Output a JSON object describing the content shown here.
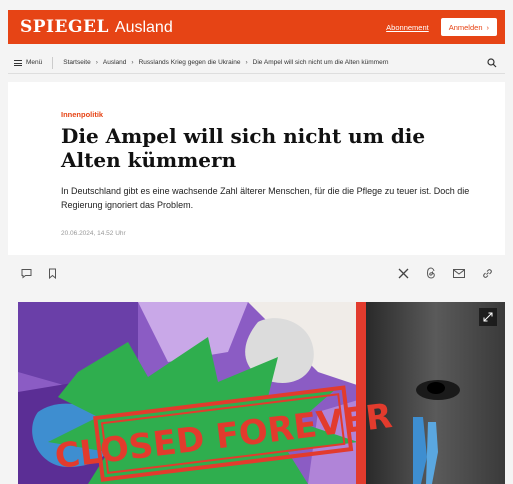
{
  "header": {
    "brand": "SPIEGEL",
    "section": "Ausland",
    "subscription_link": "Abonnement",
    "login_label": "Anmelden",
    "login_chevron": "›",
    "brand_color": "#e64415"
  },
  "nav": {
    "menu_label": "Menü",
    "breadcrumb": [
      "Startseite",
      "Ausland",
      "Russlands Krieg gegen die Ukraine",
      "Die Ampel will sich nicht um die Alten kümmern"
    ],
    "separator": "›",
    "search_icon": "search-icon"
  },
  "article": {
    "kicker": "Innenpolitik",
    "headline": "Die Ampel will sich nicht um die Alten kümmern",
    "teaser": "In Deutschland gibt es eine wachsende Zahl älterer Menschen, für die die Pflege zu teuer ist. Doch die Regierung ignoriert das Problem.",
    "dateline": "20.06.2024, 14.52 Uhr"
  },
  "actions": {
    "left_icons": [
      "comment-icon",
      "bookmark-icon"
    ],
    "right_icons": [
      "x-share-icon",
      "threads-share-icon",
      "email-share-icon",
      "link-share-icon"
    ]
  },
  "hero": {
    "stamp_text": "CLOSED FOREVER",
    "expand_icon": "expand-icon"
  }
}
